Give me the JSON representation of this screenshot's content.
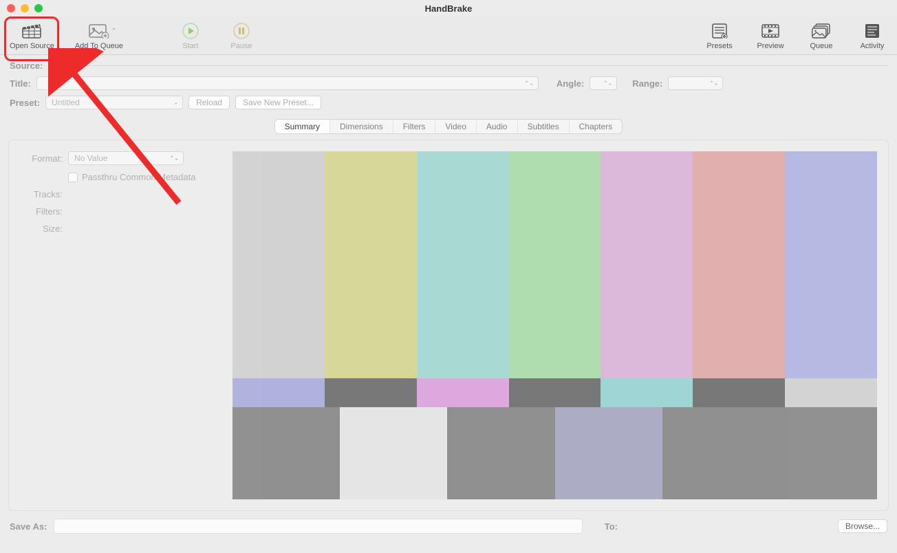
{
  "app": {
    "title": "HandBrake"
  },
  "toolbar": {
    "open_source": "Open Source",
    "add_to_queue": "Add To Queue",
    "start": "Start",
    "pause": "Pause",
    "presets": "Presets",
    "preview": "Preview",
    "queue": "Queue",
    "activity": "Activity"
  },
  "labels": {
    "source": "Source:",
    "title": "Title:",
    "angle": "Angle:",
    "range": "Range:",
    "preset": "Preset:",
    "reload": "Reload",
    "save_new_preset": "Save New Preset...",
    "format": "Format:",
    "no_value": "No Value",
    "passthru": "Passthru Common Metadata",
    "tracks": "Tracks:",
    "filters": "Filters:",
    "size": "Size:",
    "save_as": "Save As:",
    "to": "To:",
    "browse": "Browse...",
    "untitled": "Untitled"
  },
  "tabs": [
    "Summary",
    "Dimensions",
    "Filters",
    "Video",
    "Audio",
    "Subtitles",
    "Chapters"
  ],
  "active_tab": 0,
  "color_bars": {
    "top": [
      "#c5c5c5",
      "#cccc6b",
      "#84d0c6",
      "#8ed58e",
      "#d39cd1",
      "#dd8e8e",
      "#989edb"
    ],
    "mid": [
      "#8e93d4",
      "#3a3a3a",
      "#d684d6",
      "#3a3a3a",
      "#77c9c9",
      "#3a3a3a",
      "#c5c5c5"
    ],
    "bot": [
      "#6d6d6d",
      "#e2e2e2",
      "#6d6d6d",
      "#9494b5",
      "#6d6d6d",
      "#6d6d6d"
    ]
  }
}
